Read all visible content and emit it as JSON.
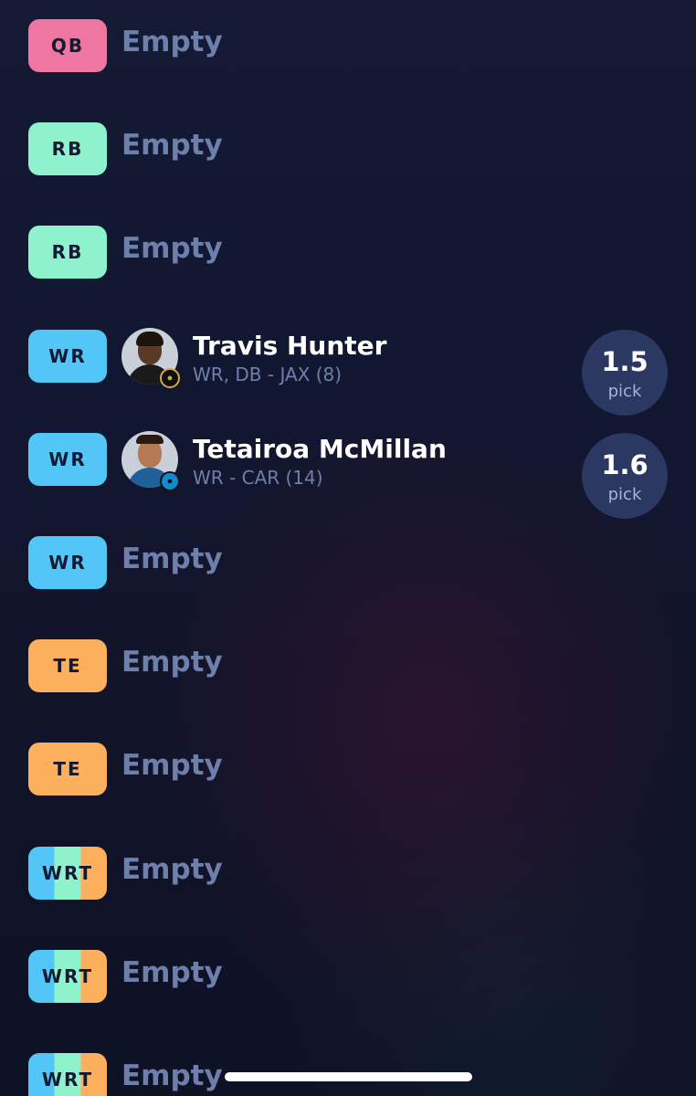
{
  "empty_label": "Empty",
  "pick_label": "pick",
  "rows": [
    {
      "position": "QB",
      "player": null
    },
    {
      "position": "RB",
      "player": null
    },
    {
      "position": "RB",
      "player": null
    },
    {
      "position": "WR",
      "player": {
        "name": "Travis Hunter",
        "info": "WR, DB - JAX (8)",
        "pick": "1.5"
      }
    },
    {
      "position": "WR",
      "player": {
        "name": "Tetairoa McMillan",
        "info": "WR - CAR (14)",
        "pick": "1.6"
      }
    },
    {
      "position": "WR",
      "player": null
    },
    {
      "position": "TE",
      "player": null
    },
    {
      "position": "TE",
      "player": null
    },
    {
      "position": "WRT",
      "player": null
    },
    {
      "position": "WRT",
      "player": null
    },
    {
      "position": "WRT",
      "player": null
    }
  ],
  "colors": {
    "QB": "#ee76a0",
    "RB": "#8ef2cd",
    "WR": "#52c6f6",
    "TE": "#fcb05e",
    "pick_bubble": "#2a3862",
    "background": "#121731"
  }
}
